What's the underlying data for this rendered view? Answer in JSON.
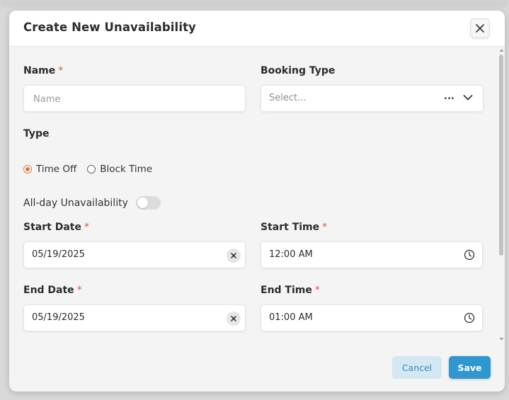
{
  "modal": {
    "title": "Create New Unavailability",
    "close_icon": "close-icon"
  },
  "form": {
    "name": {
      "label": "Name",
      "required_mark": "*",
      "placeholder": "Name",
      "value": ""
    },
    "booking_type": {
      "label": "Booking Type",
      "placeholder": "Select...",
      "ellipsis": "...",
      "icon": "chevron-down-icon"
    },
    "type": {
      "label": "Type",
      "options": [
        {
          "label": "Time Off",
          "checked": true
        },
        {
          "label": "Block Time",
          "checked": false
        }
      ]
    },
    "all_day": {
      "label": "All-day Unavailability",
      "on": false
    },
    "start_date": {
      "label": "Start Date",
      "required_mark": "*",
      "value": "05/19/2025",
      "icon": "clear-icon"
    },
    "start_time": {
      "label": "Start Time",
      "required_mark": "*",
      "value": "12:00 AM",
      "icon": "clock-icon"
    },
    "end_date": {
      "label": "End Date",
      "required_mark": "*",
      "value": "05/19/2025",
      "icon": "clear-icon"
    },
    "end_time": {
      "label": "End Time",
      "required_mark": "*",
      "value": "01:00 AM",
      "icon": "clock-icon"
    }
  },
  "footer": {
    "cancel_label": "Cancel",
    "save_label": "Save"
  },
  "colors": {
    "accent_orange": "#e2733a",
    "required_red": "#e0533a",
    "primary_blue": "#2f97cf",
    "secondary_blue_bg": "#d3e8f3"
  }
}
